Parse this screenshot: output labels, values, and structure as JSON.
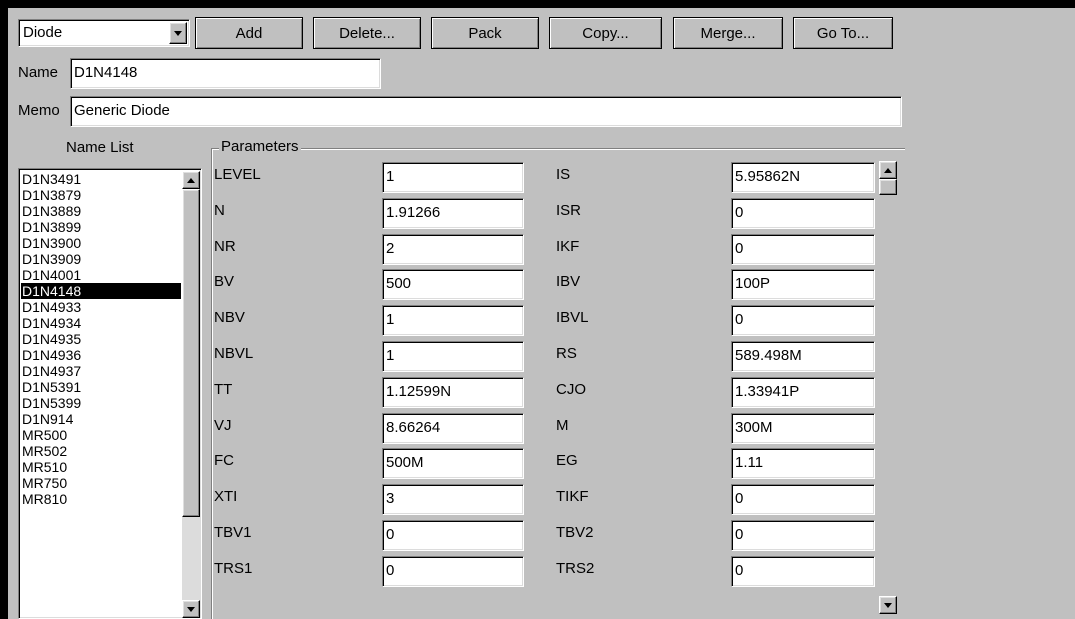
{
  "toolbar": {
    "type_select_value": "Diode",
    "buttons": [
      "Add",
      "Delete...",
      "Pack",
      "Copy...",
      "Merge...",
      "Go To..."
    ]
  },
  "form": {
    "name_label": "Name",
    "name_value": "D1N4148",
    "memo_label": "Memo",
    "memo_value": "Generic Diode"
  },
  "name_list": {
    "title": "Name List",
    "items": [
      "D1N3491",
      "D1N3879",
      "D1N3889",
      "D1N3899",
      "D1N3900",
      "D1N3909",
      "D1N4001",
      "D1N4148",
      "D1N4933",
      "D1N4934",
      "D1N4935",
      "D1N4936",
      "D1N4937",
      "D1N5391",
      "D1N5399",
      "D1N914",
      "MR500",
      "MR502",
      "MR510",
      "MR750",
      "MR810"
    ],
    "selected": "D1N4148"
  },
  "parameters": {
    "title": "Parameters",
    "rows": [
      {
        "l1": "LEVEL",
        "v1": "1",
        "l2": "IS",
        "v2": "5.95862N"
      },
      {
        "l1": "N",
        "v1": "1.91266",
        "l2": "ISR",
        "v2": "0"
      },
      {
        "l1": "NR",
        "v1": "2",
        "l2": "IKF",
        "v2": "0"
      },
      {
        "l1": "BV",
        "v1": "500",
        "l2": "IBV",
        "v2": "100P"
      },
      {
        "l1": "NBV",
        "v1": "1",
        "l2": "IBVL",
        "v2": "0"
      },
      {
        "l1": "NBVL",
        "v1": "1",
        "l2": "RS",
        "v2": "589.498M"
      },
      {
        "l1": "TT",
        "v1": "1.12599N",
        "l2": "CJO",
        "v2": "1.33941P"
      },
      {
        "l1": "VJ",
        "v1": "8.66264",
        "l2": "M",
        "v2": "300M"
      },
      {
        "l1": "FC",
        "v1": "500M",
        "l2": "EG",
        "v2": "1.11"
      },
      {
        "l1": "XTI",
        "v1": "3",
        "l2": "TIKF",
        "v2": "0"
      },
      {
        "l1": "TBV1",
        "v1": "0",
        "l2": "TBV2",
        "v2": "0"
      },
      {
        "l1": "TRS1",
        "v1": "0",
        "l2": "TRS2",
        "v2": "0"
      }
    ]
  }
}
